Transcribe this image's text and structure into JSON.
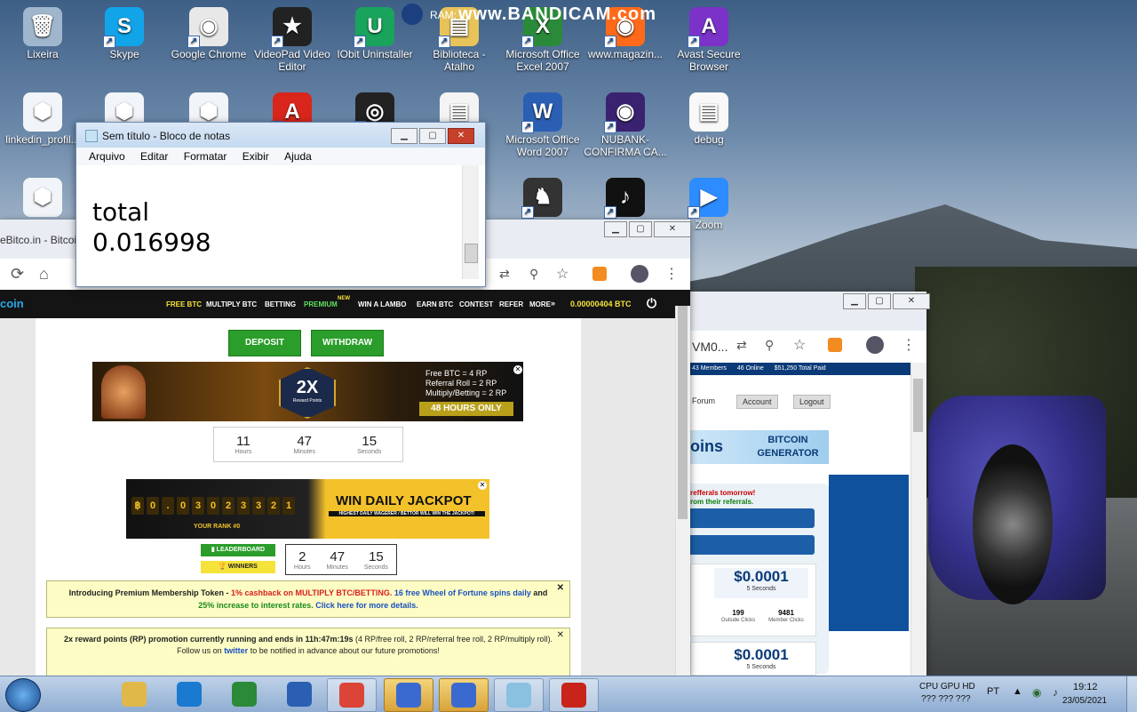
{
  "desktop_icons": [
    {
      "label": "Lixeira",
      "color": "#9fb6cc",
      "glyph": "🗑"
    },
    {
      "label": "Skype",
      "color": "#12a4e8",
      "glyph": "S"
    },
    {
      "label": "Google Chrome",
      "color": "#e8e8e8",
      "glyph": "◉"
    },
    {
      "label": "VideoPad Video Editor",
      "color": "#222",
      "glyph": "★"
    },
    {
      "label": "IObit Uninstaller",
      "color": "#19a35c",
      "glyph": "U"
    },
    {
      "label": "Biblioteca - Atalho",
      "color": "#e8c35a",
      "glyph": "▤"
    },
    {
      "label": "Microsoft Office Excel 2007",
      "color": "#2a8a3a",
      "glyph": "X"
    },
    {
      "label": "www.magazin...",
      "color": "#ff6a1a",
      "glyph": "◉"
    },
    {
      "label": "Avast Secure Browser",
      "color": "#7a32c8",
      "glyph": "A"
    },
    {
      "label": "linkedin_profil...",
      "color": "#f1f4f8",
      "glyph": "⬢"
    },
    {
      "label": "",
      "color": "#f1f4f8",
      "glyph": "⬢"
    },
    {
      "label": "",
      "color": "#f1f4f8",
      "glyph": "⬢"
    },
    {
      "label": "",
      "color": "#d9261c",
      "glyph": "A"
    },
    {
      "label": "",
      "color": "#222",
      "glyph": "◎"
    },
    {
      "label": "",
      "color": "#f4f4f4",
      "glyph": "▤"
    },
    {
      "label": "Microsoft Office Word 2007",
      "color": "#2b5fb3",
      "glyph": "W"
    },
    {
      "label": "NUBANK- CONFIRMA CA...",
      "color": "#3a2270",
      "glyph": "◉"
    },
    {
      "label": "debug",
      "color": "#f8f8f8",
      "glyph": "▤"
    },
    {
      "label": "",
      "color": "#f1f4f8",
      "glyph": "⬢"
    },
    {
      "label": "",
      "color": "#333",
      "glyph": "♞"
    },
    {
      "label": "",
      "color": "#111",
      "glyph": "♪"
    },
    {
      "label": "Zoom",
      "color": "#2d8cff",
      "glyph": "▶"
    }
  ],
  "bandicam": {
    "ram_label": "RAM:",
    "logo": "www.BANDICAM.com"
  },
  "notepad": {
    "title": "Sem título - Bloco de notas",
    "menu": [
      "Arquivo",
      "Editar",
      "Formatar",
      "Exibir",
      "Ajuda"
    ],
    "lines": [
      "total",
      "0.016998"
    ]
  },
  "chrome_left": {
    "tab_text": "eBitco.in - Bitcoi",
    "nav": {
      "logo": "coin",
      "items": [
        "FREE BTC",
        "MULTIPLY BTC",
        "BETTING",
        "PREMIUM",
        "WIN A LAMBO",
        "EARN BTC",
        "CONTEST",
        "REFER",
        "MORE"
      ],
      "premium_badge": "NEW",
      "balance": "0.00000404 BTC"
    },
    "buttons": {
      "deposit": "DEPOSIT",
      "withdraw": "WITHDRAW"
    },
    "reward_banner": {
      "big": "2X",
      "sub": "Reward Points",
      "lines": [
        "Free BTC = 4 RP",
        "Referral Roll = 2 RP",
        "Multiply/Betting = 2 RP"
      ],
      "cta": "48 HOURS ONLY"
    },
    "timer1": [
      {
        "n": "11",
        "l": "Hours"
      },
      {
        "n": "47",
        "l": "Minutes"
      },
      {
        "n": "15",
        "l": "Seconds"
      }
    ],
    "jackpot": {
      "digits": [
        "฿",
        "0",
        ".",
        "0",
        "3",
        "0",
        "2",
        "3",
        "3",
        "2",
        "1"
      ],
      "title": "WIN DAILY JACKPOT",
      "sub": "HIGHEST DAILY WAGERER / BETTOR WILL WIN THE JACKPOT!",
      "rank": "YOUR RANK #0"
    },
    "leaderboard": "LEADERBOARD",
    "winners": "WINNERS",
    "timer2": [
      {
        "n": "2",
        "l": "Hours"
      },
      {
        "n": "47",
        "l": "Minutes"
      },
      {
        "n": "15",
        "l": "Seconds"
      }
    ],
    "notice1": {
      "a": "Introducing Premium Membership Token - ",
      "b": "1% cashback on MULTIPLY BTC/BETTING.",
      "c": " 16 free Wheel of Fortune spins daily",
      "d": " and ",
      "e": "25% increase to interest rates.",
      "f": " Click here for more details."
    },
    "notice2": {
      "a": "2x reward points (RP) promotion currently running and ends in 11h:47m:19s",
      "b": " (4 RP/free roll, 2 RP/referral free roll, 2 RP/multiply roll).",
      "c": "Follow us on ",
      "d": "twitter",
      "e": " to be notified in advance about our future promotions!"
    }
  },
  "chrome_right": {
    "url_fragment": "VM0...",
    "stats": [
      "43 Members",
      "46 Online",
      "$51,250 Total Paid"
    ],
    "links": [
      "Forum",
      "Account",
      "Logout"
    ],
    "banner_left": "oins",
    "banner_right": "BITCOIN GENERATOR",
    "refer_lines": [
      "refferals tomorrow!",
      "rom their referrals."
    ],
    "card1": {
      "price": "$0.0001",
      "secs": "5 Seconds",
      "c1": "199",
      "c1l": "Outside Clicks",
      "c2": "9481",
      "c2l": "Member Clicks"
    },
    "card2": {
      "price": "$0.0001",
      "secs": "5 Seconds"
    }
  },
  "taskbar": {
    "apps": [
      {
        "name": "windows-explorer",
        "color": "#e0b84a",
        "state": "normal"
      },
      {
        "name": "ccleaner",
        "color": "#1a7ad0",
        "state": "normal"
      },
      {
        "name": "excel",
        "color": "#2a8a3a",
        "state": "normal"
      },
      {
        "name": "word",
        "color": "#2b5fb3",
        "state": "normal"
      },
      {
        "name": "chrome",
        "color": "#db4437",
        "state": "open"
      },
      {
        "name": "security-shield",
        "color": "#3a6ad0",
        "state": "active"
      },
      {
        "name": "security-shield-2",
        "color": "#3a6ad0",
        "state": "active"
      },
      {
        "name": "notepad",
        "color": "#8ac0e0",
        "state": "open"
      },
      {
        "name": "bandicam",
        "color": "#c8241a",
        "state": "open"
      }
    ],
    "sysinfo_top": "CPU GPU HD",
    "sysinfo_bottom": "???  ??? ???",
    "lang": "PT",
    "time": "19:12",
    "date": "23/05/2021"
  }
}
